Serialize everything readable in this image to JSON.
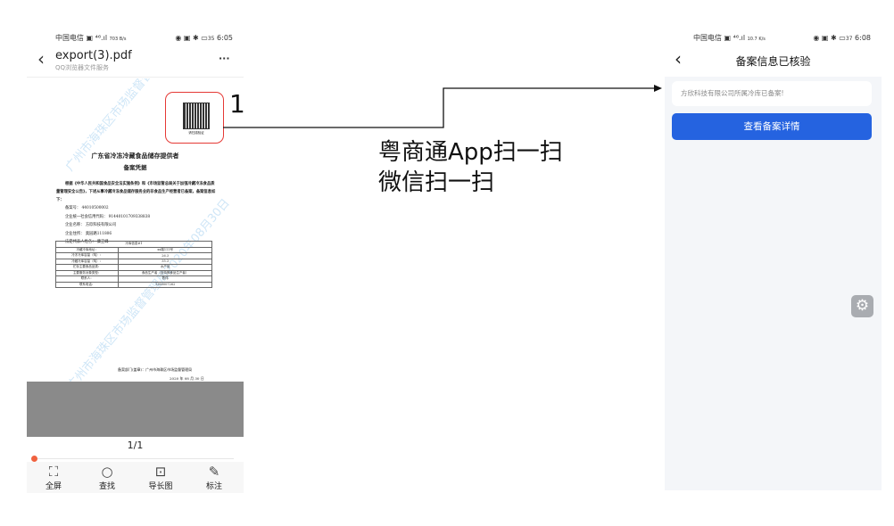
{
  "left_phone": {
    "status": {
      "carrier": "中国电信",
      "speed": "703 B/s",
      "battery": "35",
      "time": "6:05"
    },
    "title": "export(3).pdf",
    "subtitle": "QQ浏览器文件服务",
    "more": "···",
    "doc": {
      "title": "广东省冷冻冷藏食品储存提供者",
      "subtitle": "备案凭据",
      "body": "根据《中华人民共和国食品安全法实施条例》和《市场监管总局关于加强冷藏冷冻食品质量管理安全公告》，下述从事冷藏冷冻食品储存服务业的非食品生产经营者已备案，备案信息如下：",
      "fields": [
        "备案号：  44010500002",
        "企业统一社会信用代码：  91440101709338838",
        "企业名称：  方欣科技有限公司",
        "企业住所：  奥园路111806",
        "法定代表人姓名：  康卫峰"
      ],
      "table_header": "冷库信息#1",
      "table_rows": [
        [
          "冷藏冷库地址：",
          "xx路111号"
        ],
        [
          "冷冻冷库容量（吨）：",
          "26.3"
        ],
        [
          "冷藏冷库容量（吨）：",
          "35.3"
        ],
        [
          "贮存主要食品品类：",
          "水产品"
        ],
        [
          "主要服务对象类型：",
          "食品生产者（含特殊食品生产者）"
        ],
        [
          "联系人：",
          "陈伟"
        ],
        [
          "联系电话：",
          "1360007262"
        ]
      ],
      "footer_dept": "备案部门(盖章)：广州市海珠区市场监督管理局",
      "footer_date": "2020 年 08 月 30 日",
      "watermark": "广州市海珠区市场监督管理局2020年08月30日",
      "qr_caption": "请扫描验证"
    },
    "page_indicator": "1/1",
    "progress": 0.0,
    "toolbar": [
      {
        "label": "全屏",
        "icon": "fullscreen-icon"
      },
      {
        "label": "查找",
        "icon": "search-icon"
      },
      {
        "label": "导长图",
        "icon": "long-image-icon"
      },
      {
        "label": "标注",
        "icon": "pencil-icon"
      }
    ]
  },
  "annotation": {
    "number": "1",
    "line1": "粤商通App扫一扫",
    "line2": "微信扫一扫",
    "highlight_color": "#e53935"
  },
  "right_phone": {
    "status": {
      "carrier": "中国电信",
      "speed": "10.7 K/s",
      "battery": "37",
      "time": "6:08"
    },
    "title": "备案信息已核验",
    "message": "方欣科技有限公司所属冷库已备案!",
    "button": "查看备案详情",
    "accent": "#2563e0"
  }
}
